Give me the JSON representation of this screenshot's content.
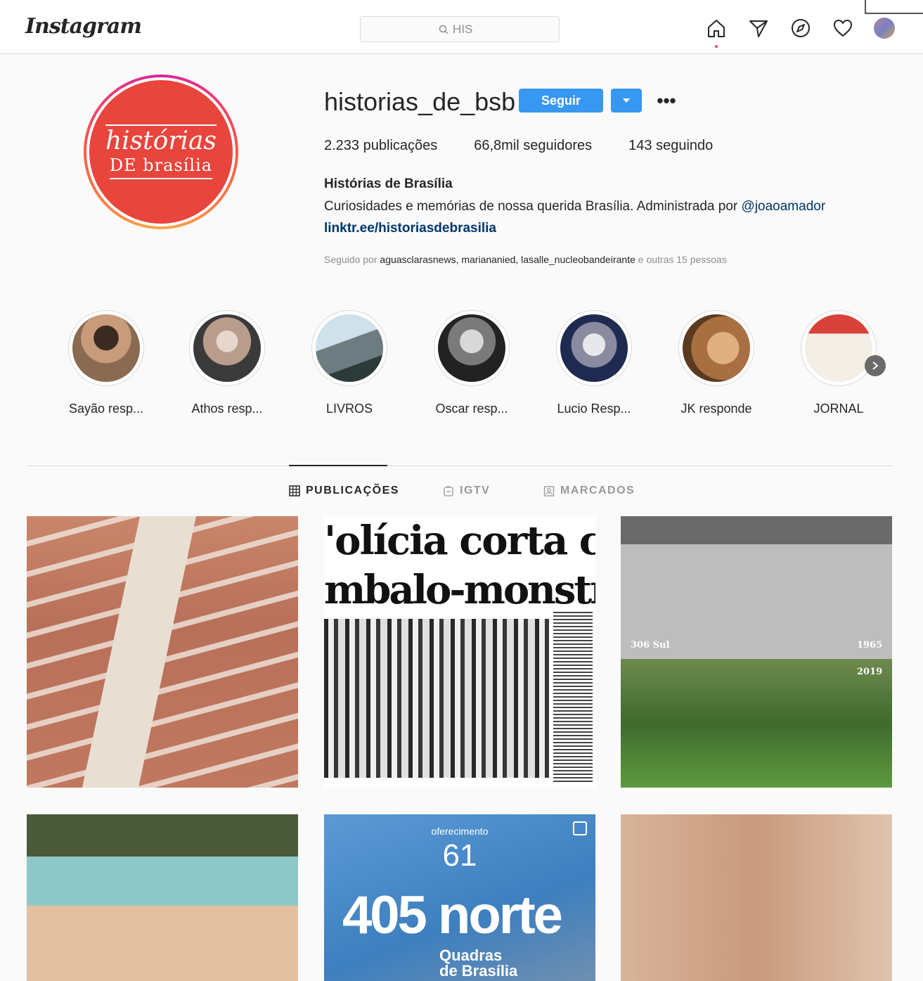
{
  "header": {
    "logo": "Instagram",
    "search_value": "HIS",
    "icons": [
      "home-icon",
      "direct-icon",
      "explore-icon",
      "heart-icon",
      "avatar"
    ]
  },
  "profile": {
    "avatar_line1": "histórias",
    "avatar_line2": "DE brasília",
    "username": "historias_de_bsb",
    "follow_label": "Seguir",
    "more_label": "•••",
    "stats": {
      "posts_count": "2.233",
      "posts_label": "publicações",
      "followers_count": "66,8mil",
      "followers_label": "seguidores",
      "following_count": "143",
      "following_label": "seguindo"
    },
    "full_name": "Histórias de Brasília",
    "bio_text": "Curiosidades e memórias de nossa querida Brasília. Administrada por ",
    "bio_mention": "@joaoamador",
    "link": "linktr.ee/historiasdebrasilia",
    "followed_prefix": "Seguido por ",
    "followed_names": "aguasclarasnews, mariananied, lasalle_nucleobandeirante",
    "followed_suffix": " e outras 15 pessoas"
  },
  "highlights": [
    {
      "label": "Sayão resp..."
    },
    {
      "label": "Athos resp..."
    },
    {
      "label": "LIVROS"
    },
    {
      "label": "Oscar resp..."
    },
    {
      "label": "Lucio Resp..."
    },
    {
      "label": "JK responde"
    },
    {
      "label": "JORNAL"
    }
  ],
  "tabs": {
    "posts": "PUBLICAÇÕES",
    "igtv": "IGTV",
    "tagged": "MARCADOS"
  },
  "posts": {
    "p2_headline1": "'olícia corta c",
    "p2_headline2": "mbalo-monstr",
    "p3_caption_left": "306 Sul",
    "p3_caption_right": "1965",
    "p3_caption_2019": "2019",
    "p5_offer": "oferecimento",
    "p5_number": "61",
    "p5_big": "405 norte",
    "p5_sub1": "Quadras",
    "p5_sub2": "de Brasília"
  },
  "colors": {
    "accent_blue": "#3897f0",
    "link_blue": "#003569",
    "avatar_red": "#e8453c"
  }
}
